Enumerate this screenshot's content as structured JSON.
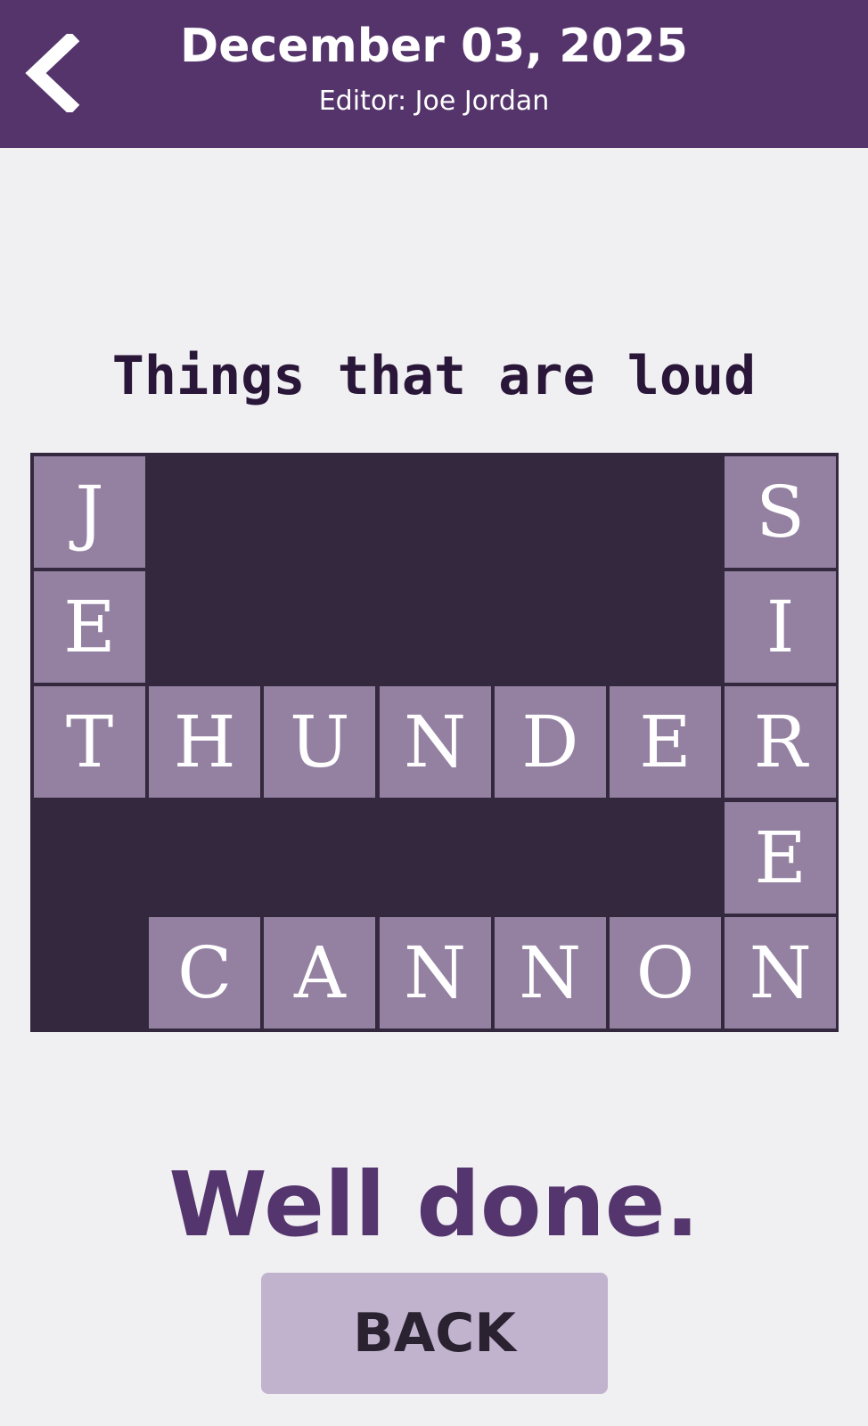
{
  "header": {
    "back_icon": "chevron-left-icon",
    "title": "December 03, 2025",
    "subtitle": "Editor: Joe Jordan"
  },
  "puzzle": {
    "title": "Things that are loud",
    "rows": [
      [
        "J",
        "",
        "",
        "",
        "",
        "",
        "S"
      ],
      [
        "E",
        "",
        "",
        "",
        "",
        "",
        "I"
      ],
      [
        "T",
        "H",
        "U",
        "N",
        "D",
        "E",
        "R"
      ],
      [
        "",
        "",
        "",
        "",
        "",
        "",
        "E"
      ],
      [
        "",
        "C",
        "A",
        "N",
        "N",
        "O",
        "N"
      ]
    ]
  },
  "result": {
    "message": "Well done.",
    "back_label": "BACK"
  },
  "colors": {
    "header_bg": "#54346b",
    "grid_bg": "#33283d",
    "tile_bg": "#9481a1",
    "button_bg": "#c1b3ce",
    "accent_text": "#55356d"
  }
}
